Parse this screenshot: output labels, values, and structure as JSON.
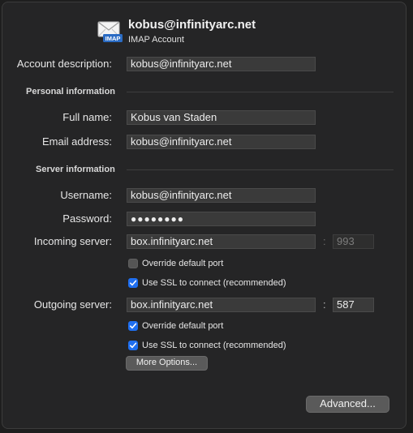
{
  "header": {
    "account_title": "kobus@infinityarc.net",
    "account_type": "IMAP Account",
    "icon": "envelope-imap-icon",
    "icon_badge": "IMAP"
  },
  "fields": {
    "account_description": {
      "label": "Account description:",
      "value": "kobus@infinityarc.net"
    },
    "full_name": {
      "label": "Full name:",
      "value": "Kobus van Staden"
    },
    "email_address": {
      "label": "Email address:",
      "value": "kobus@infinityarc.net"
    },
    "username": {
      "label": "Username:",
      "value": "kobus@infinityarc.net"
    },
    "password": {
      "label": "Password:",
      "value": "●●●●●●●●"
    },
    "incoming_server": {
      "label": "Incoming server:",
      "value": "box.infinityarc.net",
      "port": "993"
    },
    "outgoing_server": {
      "label": "Outgoing server:",
      "value": "box.infinityarc.net",
      "port": "587"
    }
  },
  "sections": {
    "personal": "Personal information",
    "server": "Server information"
  },
  "port_separator": ":",
  "incoming_options": {
    "override_port": {
      "label": "Override default port",
      "checked": false
    },
    "use_ssl": {
      "label": "Use SSL to connect (recommended)",
      "checked": true
    }
  },
  "outgoing_options": {
    "override_port": {
      "label": "Override default port",
      "checked": true
    },
    "use_ssl": {
      "label": "Use SSL to connect (recommended)",
      "checked": true
    }
  },
  "buttons": {
    "more_options": "More Options...",
    "advanced": "Advanced..."
  },
  "colors": {
    "checkbox_on": "#1f6ff0",
    "background": "#252526"
  }
}
